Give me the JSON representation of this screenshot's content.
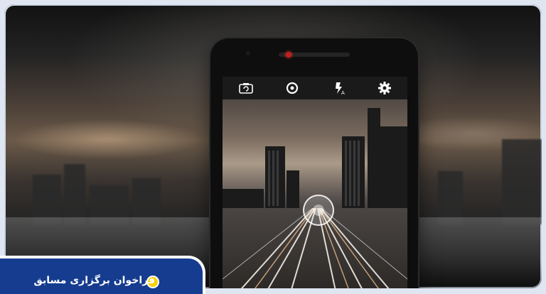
{
  "phone": {
    "toolbar_icons": [
      "switch-camera-icon",
      "shutter-mode-icon",
      "flash-auto-icon",
      "settings-icon"
    ]
  },
  "badge": {
    "text": "فراخوان برگزاری مسابق",
    "dot_color": "#f5d10a",
    "background": "#153c8f"
  }
}
